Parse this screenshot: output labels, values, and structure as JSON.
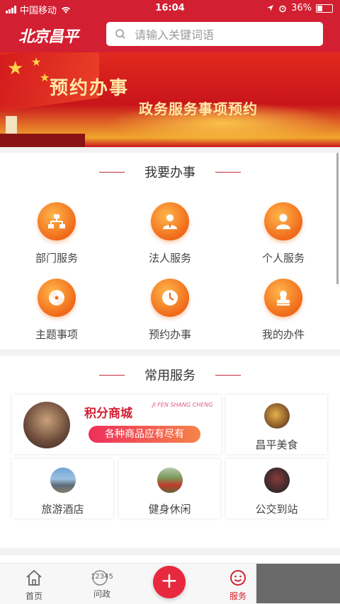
{
  "status_bar": {
    "carrier": "中国移动",
    "time": "16:04",
    "battery": "36%"
  },
  "header": {
    "logo": "北京昌平",
    "search_placeholder": "请输入关键词语"
  },
  "banner": {
    "title": "预约办事",
    "subtitle": "政务服务事项预约",
    "slide_count": 3,
    "active_slide": 1
  },
  "section_main": {
    "title": "我要办事",
    "items": [
      {
        "label": "部门服务",
        "icon": "org-chart-icon"
      },
      {
        "label": "法人服务",
        "icon": "business-person-icon"
      },
      {
        "label": "个人服务",
        "icon": "person-icon"
      },
      {
        "label": "主题事项",
        "icon": "theme-pinwheel-icon"
      },
      {
        "label": "预约办事",
        "icon": "clock-icon"
      },
      {
        "label": "我的办件",
        "icon": "stamp-icon"
      }
    ]
  },
  "section_common": {
    "title": "常用服务",
    "mall": {
      "title": "积分商城",
      "pinyin": "JI FEN SHANG CHENG",
      "tagline": "各种商品应有尽有"
    },
    "cards": [
      {
        "label": "昌平美食"
      },
      {
        "label": "旅游酒店"
      },
      {
        "label": "健身休闲"
      },
      {
        "label": "公交到站"
      }
    ]
  },
  "tabbar": {
    "items": [
      {
        "label": "首页",
        "icon": "home-icon"
      },
      {
        "label": "问政",
        "icon": "hotline-12345-icon",
        "icon_text": "12345"
      },
      {
        "label": "服务",
        "icon": "smile-icon"
      }
    ],
    "fab": "+",
    "colors": {
      "accent": "#d21f32"
    }
  }
}
